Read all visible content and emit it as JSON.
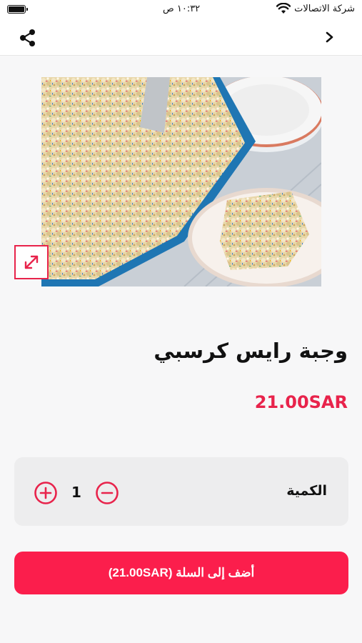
{
  "status_bar": {
    "carrier": "شركة الاتصالات",
    "time": "١٠:٣٢ ص",
    "battery_level": 1.0
  },
  "nav": {
    "share_icon": "share-icon",
    "back_icon": "chevron-right-icon"
  },
  "product": {
    "title": "وجبة رايس كرسبي",
    "price": "21.00SAR",
    "image_icon": "expand-icon"
  },
  "quantity": {
    "label": "الكمية",
    "value": "1",
    "plus_icon": "plus-circle-icon",
    "minus_icon": "minus-circle-icon"
  },
  "cart": {
    "button_label": "أضف إلى السلة (21.00SAR)"
  },
  "colors": {
    "accent": "#fb1e4c",
    "price": "#e8234b",
    "background": "#f7f7f8",
    "card": "#ededee"
  }
}
